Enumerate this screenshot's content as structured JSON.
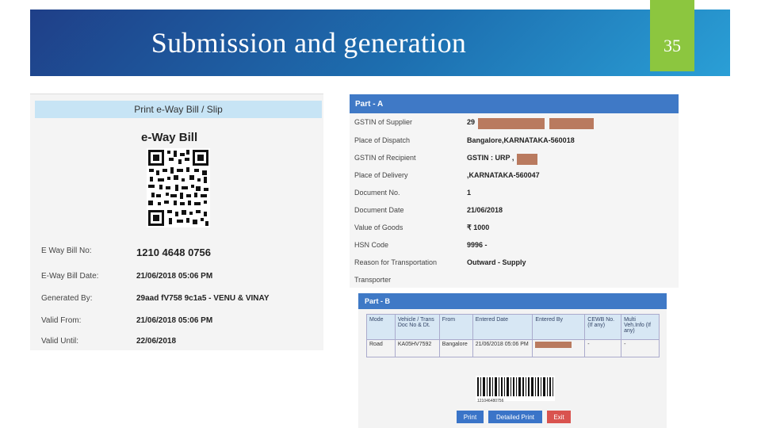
{
  "slide": {
    "title": "Submission and generation",
    "number": "35",
    "colors": {
      "banner": "#1d6fb0",
      "number_box": "#8cc63f"
    }
  },
  "slip": {
    "header": "Print e-Way Bill / Slip",
    "title": "e-Way Bill",
    "rows": [
      {
        "label": "E Way Bill No:",
        "value": "1210 4648 0756"
      },
      {
        "label": "E-Way Bill Date:",
        "value": "21/06/2018 05:06 PM"
      },
      {
        "label": "Generated By:",
        "value": "29aad fV758 9c1a5 - VENU & VINAY"
      },
      {
        "label": "Valid From:",
        "value": "21/06/2018 05:06 PM"
      },
      {
        "label": "Valid Until:",
        "value": "22/06/2018"
      }
    ]
  },
  "part_a": {
    "header": "Part - A",
    "rows": [
      {
        "label": "GSTIN of Supplier",
        "value": "29"
      },
      {
        "label": "Place of Dispatch",
        "value": "Bangalore,KARNATAKA-560018"
      },
      {
        "label": "GSTIN of Recipient",
        "value": "GSTIN : URP ,"
      },
      {
        "label": "Place of Delivery",
        "value": ",KARNATAKA-560047"
      },
      {
        "label": "Document No.",
        "value": "1"
      },
      {
        "label": "Document Date",
        "value": "21/06/2018"
      },
      {
        "label": "Value of Goods",
        "value": "₹ 1000"
      },
      {
        "label": "HSN Code",
        "value": "9996 -"
      },
      {
        "label": "Reason for Transportation",
        "value": "Outward - Supply"
      },
      {
        "label": "Transporter",
        "value": ""
      }
    ]
  },
  "part_b": {
    "header": "Part - B",
    "columns": [
      "Mode",
      "Vehicle / Trans Doc No & Dt.",
      "From",
      "Entered Date",
      "Entered By",
      "CEWB No. (If any)",
      "Multi Veh.Info (If any)"
    ],
    "rows": [
      [
        "Road",
        "KA05HV7592",
        "Bangalore",
        "21/06/2018 05:06 PM",
        "",
        "-",
        "-"
      ]
    ],
    "barcode_text": "121046480756",
    "buttons": {
      "print": "Print",
      "detailed_print": "Detailed Print",
      "exit": "Exit"
    }
  }
}
